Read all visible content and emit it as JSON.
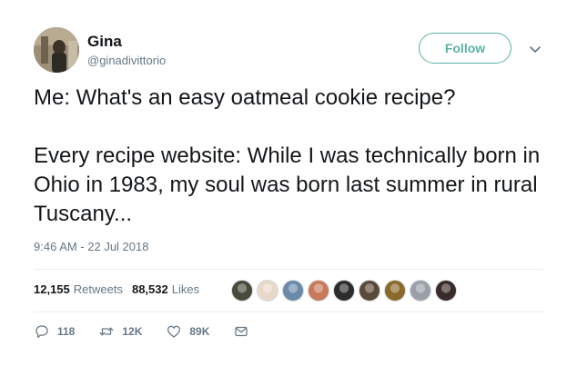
{
  "user": {
    "display_name": "Gina",
    "handle": "@ginadivittorio"
  },
  "follow_label": "Follow",
  "tweet": {
    "line1": "Me: What's an easy oatmeal cookie recipe?",
    "line2": "Every recipe website: While I was technically born in Ohio in 1983, my soul was born last summer in rural Tuscany...",
    "timestamp": "9:46 AM - 22 Jul 2018"
  },
  "stats": {
    "retweets_count": "12,155",
    "retweets_label": "Retweets",
    "likes_count": "88,532",
    "likes_label": "Likes"
  },
  "likers": [
    {
      "name": "liker-avatar-1",
      "color": "#4a4a3a"
    },
    {
      "name": "liker-avatar-2",
      "color": "#e8d8c8"
    },
    {
      "name": "liker-avatar-3",
      "color": "#6b8aa8"
    },
    {
      "name": "liker-avatar-4",
      "color": "#c97a5a"
    },
    {
      "name": "liker-avatar-5",
      "color": "#2c2c2c"
    },
    {
      "name": "liker-avatar-6",
      "color": "#5a4a3a"
    },
    {
      "name": "liker-avatar-7",
      "color": "#8a6a2a"
    },
    {
      "name": "liker-avatar-8",
      "color": "#9aa0a8"
    },
    {
      "name": "liker-avatar-9",
      "color": "#3a2a2a"
    }
  ],
  "actions": {
    "reply_count": "118",
    "retweet_count": "12K",
    "like_count": "89K"
  },
  "colors": {
    "accent": "#5ab1a4",
    "text_primary": "#14171a",
    "text_secondary": "#657786",
    "divider": "#e6ecf0"
  },
  "icons": {
    "reply": "reply-icon",
    "retweet": "retweet-icon",
    "like": "heart-icon",
    "dm": "envelope-icon",
    "caret": "chevron-down-icon"
  }
}
